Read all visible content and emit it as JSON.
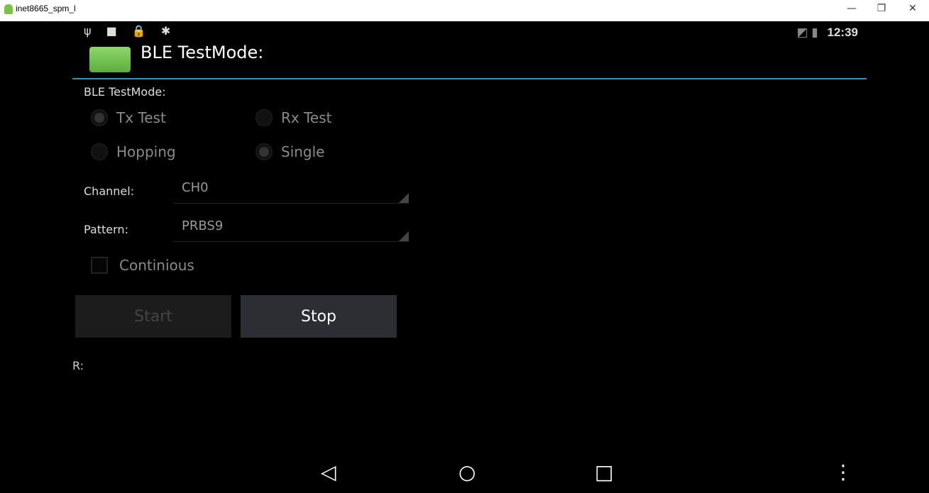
{
  "window": {
    "title": "inet8665_spm_l",
    "minimize": "—",
    "restore": "❐",
    "close": "✕"
  },
  "status_bar": {
    "time": "12:39",
    "left_icons": "ψ ■ 🔒 ✱",
    "right_icons": "◩ ▮"
  },
  "app": {
    "title": "BLE TestMode:",
    "icon_color": "#6cc04a"
  },
  "section_label": "BLE TestMode:",
  "radios": {
    "tx": {
      "label": "Tx Test",
      "checked": true
    },
    "rx": {
      "label": "Rx Test",
      "checked": false
    },
    "hopping": {
      "label": "Hopping",
      "checked": false
    },
    "single": {
      "label": "Single",
      "checked": true
    }
  },
  "channel": {
    "label": "Channel:",
    "value": "CH0"
  },
  "pattern": {
    "label": "Pattern:",
    "value": "PRBS9"
  },
  "continuous": {
    "label": "Continious",
    "checked": false
  },
  "buttons": {
    "start": "Start",
    "stop": "Stop"
  },
  "result_label": "R:",
  "navbar": {
    "back": "◁",
    "home": "○",
    "recents": "□",
    "menu": "⋮"
  },
  "colors": {
    "accent": "#3a8fb5",
    "background": "#000000"
  }
}
